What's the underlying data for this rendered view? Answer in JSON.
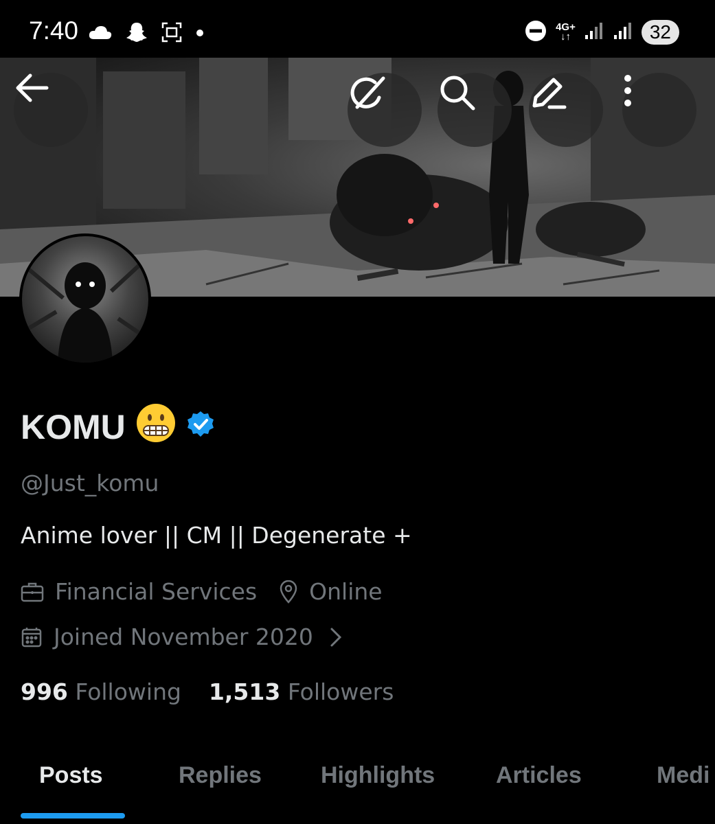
{
  "status_bar": {
    "time": "7:40",
    "network": "4G+",
    "battery": "32"
  },
  "banner": {
    "icons": [
      "back-arrow-icon",
      "grok-icon",
      "search-icon",
      "edit-icon",
      "more-icon"
    ]
  },
  "profile": {
    "name": "KOMU",
    "emoji": "😬",
    "verified": true,
    "handle": "@Just_komu",
    "bio": "Anime lover || CM || Degenerate +",
    "category": "Financial Services",
    "location": "Online",
    "joined": "Joined November 2020",
    "following_count": "996",
    "following_label": "Following",
    "followers_count": "1,513",
    "followers_label": "Followers"
  },
  "tabs": [
    {
      "label": "Posts",
      "active": true
    },
    {
      "label": "Replies"
    },
    {
      "label": "Highlights"
    },
    {
      "label": "Articles"
    },
    {
      "label": "Medi"
    }
  ],
  "colors": {
    "accent": "#1d9bf0",
    "muted": "#71767b",
    "text": "#e7e9ea",
    "background": "#000000"
  }
}
